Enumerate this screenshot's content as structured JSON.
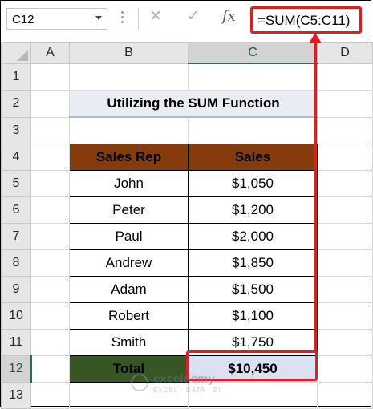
{
  "name_box": {
    "value": "C12"
  },
  "formula_bar": {
    "cancel_glyph": "✕",
    "enter_glyph": "✓",
    "fx_glyph": "fx",
    "formula": "=SUM(C5:C11)"
  },
  "columns": [
    "A",
    "B",
    "C",
    "D"
  ],
  "rows": [
    "1",
    "2",
    "3",
    "4",
    "5",
    "6",
    "7",
    "8",
    "9",
    "10",
    "11",
    "12",
    "13"
  ],
  "sheet": {
    "title": "Utilizing the SUM Function",
    "headers": [
      "Sales Rep",
      "Sales"
    ],
    "data": [
      {
        "name": "John",
        "sales": "$1,050"
      },
      {
        "name": "Peter",
        "sales": "$1,200"
      },
      {
        "name": "Paul",
        "sales": "$2,000"
      },
      {
        "name": "Andrew",
        "sales": "$1,850"
      },
      {
        "name": "Adam",
        "sales": "$1,500"
      },
      {
        "name": "Robert",
        "sales": "$1,100"
      },
      {
        "name": "Smith",
        "sales": "$1,750"
      }
    ],
    "total_label": "Total",
    "total_value": "$10,450"
  },
  "watermark": {
    "name": "exceldemy",
    "tagline": "EXCEL · DATA · BI"
  },
  "colors": {
    "header_fill": "#843c0c",
    "total_fill": "#375623",
    "total_value_fill": "#d9e1f2",
    "highlight_red": "#e31c23",
    "title_text": "#3f5f7c"
  }
}
